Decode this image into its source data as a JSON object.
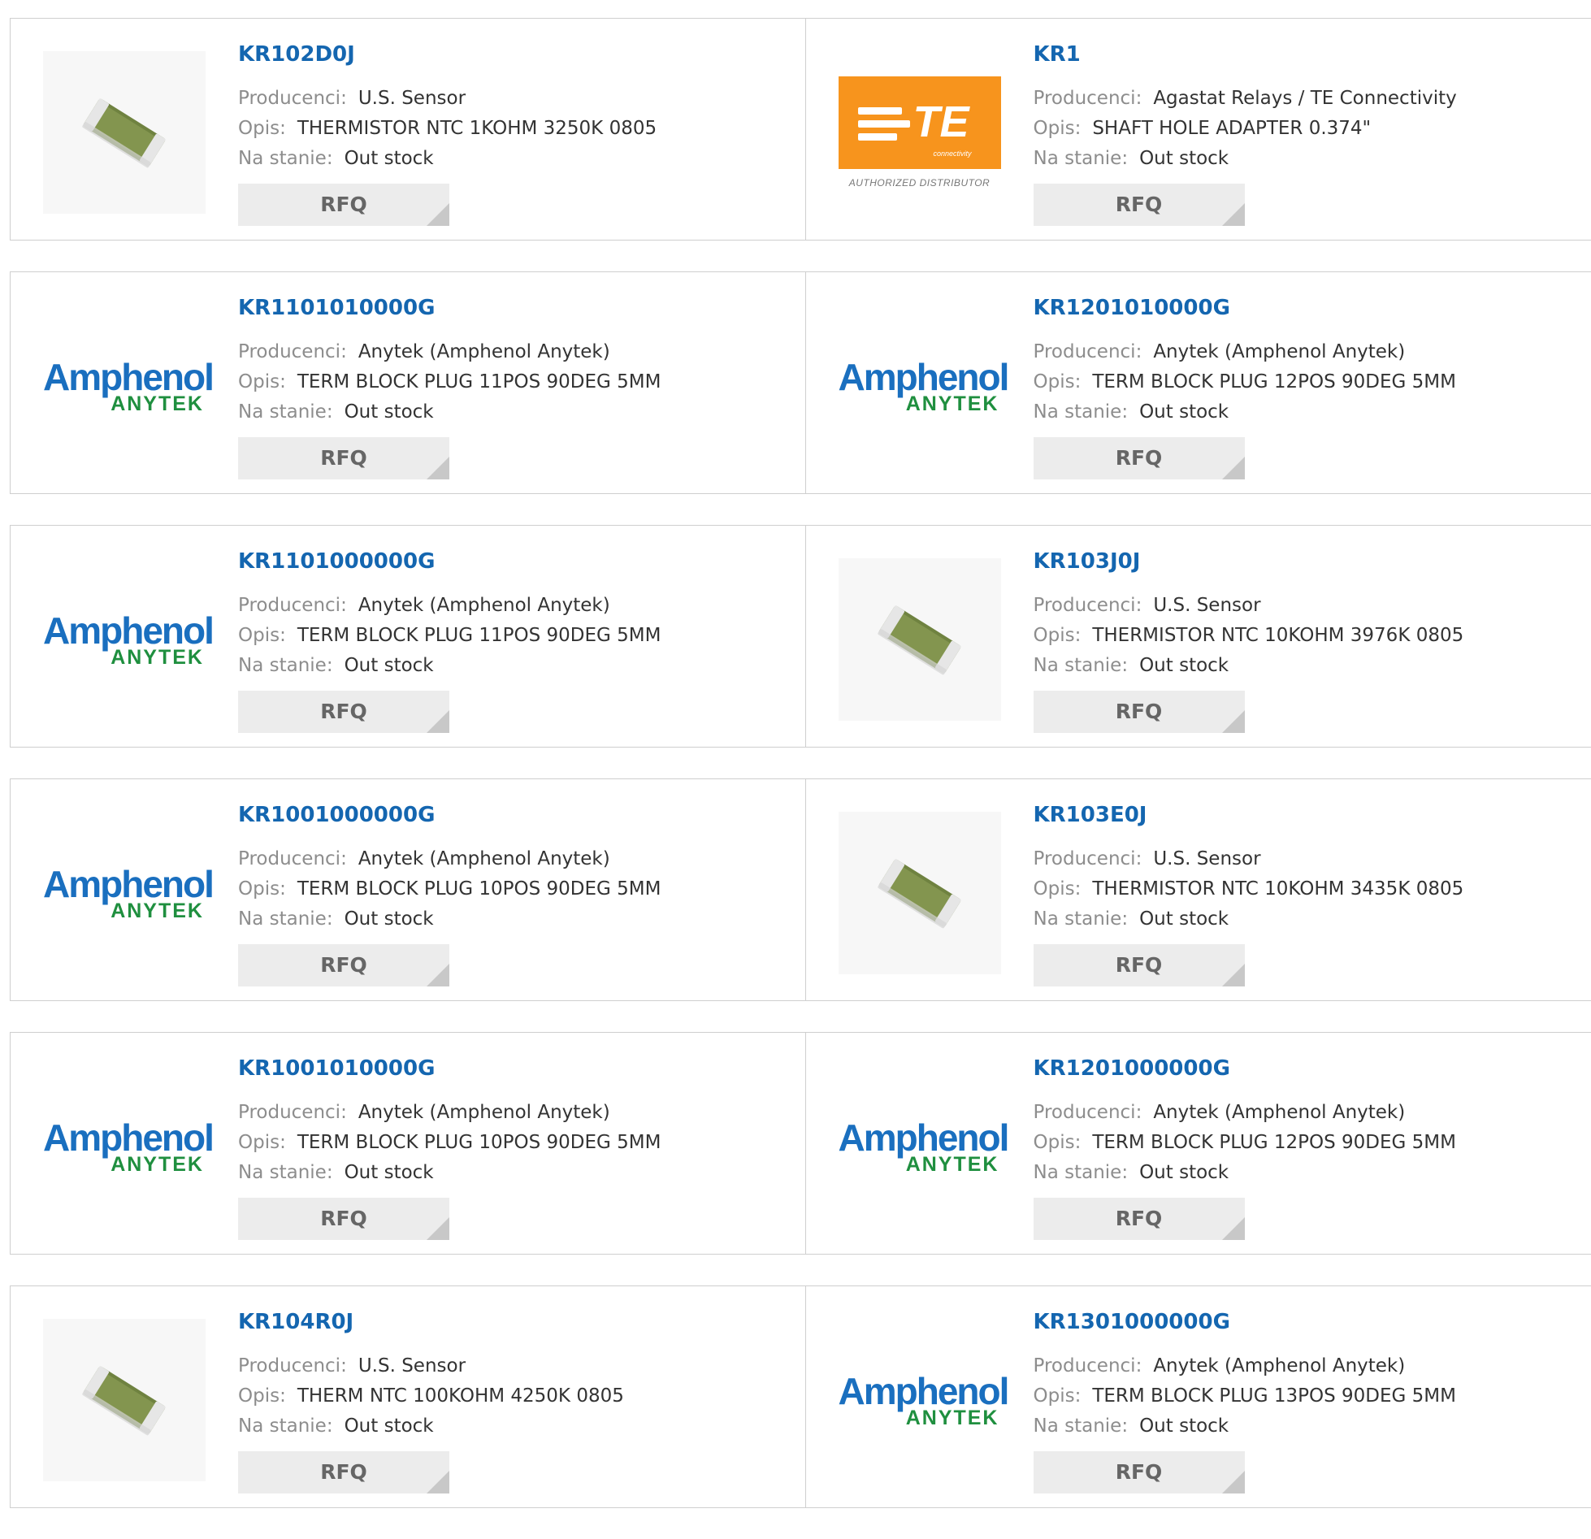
{
  "labels": {
    "manufacturer": "Producenci:",
    "description": "Opis:",
    "stock": "Na stanie:",
    "rfq": "RFQ"
  },
  "logos": {
    "amphenol_main": "Amphenol",
    "amphenol_sub": "ANYTEK",
    "te_main": "TE",
    "te_sub": "connectivity",
    "te_authorized": "AUTHORIZED DISTRIBUTOR"
  },
  "products": [
    {
      "part": "KR102D0J",
      "manufacturer": "U.S. Sensor",
      "description": "THERMISTOR NTC 1KOHM 3250K 0805",
      "stock": "Out stock",
      "image": "thermistor-chip"
    },
    {
      "part": "KR1",
      "manufacturer": "Agastat Relays / TE Connectivity",
      "description": "SHAFT HOLE ADAPTER 0.374\"",
      "stock": "Out stock",
      "image": "te-logo"
    },
    {
      "part": "KR1101010000G",
      "manufacturer": "Anytek (Amphenol Anytek)",
      "description": "TERM BLOCK PLUG 11POS 90DEG 5MM",
      "stock": "Out stock",
      "image": "amphenol-logo"
    },
    {
      "part": "KR1201010000G",
      "manufacturer": "Anytek (Amphenol Anytek)",
      "description": "TERM BLOCK PLUG 12POS 90DEG 5MM",
      "stock": "Out stock",
      "image": "amphenol-logo"
    },
    {
      "part": "KR1101000000G",
      "manufacturer": "Anytek (Amphenol Anytek)",
      "description": "TERM BLOCK PLUG 11POS 90DEG 5MM",
      "stock": "Out stock",
      "image": "amphenol-logo"
    },
    {
      "part": "KR103J0J",
      "manufacturer": "U.S. Sensor",
      "description": "THERMISTOR NTC 10KOHM 3976K 0805",
      "stock": "Out stock",
      "image": "thermistor-chip"
    },
    {
      "part": "KR1001000000G",
      "manufacturer": "Anytek (Amphenol Anytek)",
      "description": "TERM BLOCK PLUG 10POS 90DEG 5MM",
      "stock": "Out stock",
      "image": "amphenol-logo"
    },
    {
      "part": "KR103E0J",
      "manufacturer": "U.S. Sensor",
      "description": "THERMISTOR NTC 10KOHM 3435K 0805",
      "stock": "Out stock",
      "image": "thermistor-chip"
    },
    {
      "part": "KR1001010000G",
      "manufacturer": "Anytek (Amphenol Anytek)",
      "description": "TERM BLOCK PLUG 10POS 90DEG 5MM",
      "stock": "Out stock",
      "image": "amphenol-logo"
    },
    {
      "part": "KR1201000000G",
      "manufacturer": "Anytek (Amphenol Anytek)",
      "description": "TERM BLOCK PLUG 12POS 90DEG 5MM",
      "stock": "Out stock",
      "image": "amphenol-logo"
    },
    {
      "part": "KR104R0J",
      "manufacturer": "U.S. Sensor",
      "description": "THERM NTC 100KOHM 4250K 0805",
      "stock": "Out stock",
      "image": "thermistor-chip"
    },
    {
      "part": "KR1301000000G",
      "manufacturer": "Anytek (Amphenol Anytek)",
      "description": "TERM BLOCK PLUG 13POS 90DEG 5MM",
      "stock": "Out stock",
      "image": "amphenol-logo"
    }
  ],
  "colors": {
    "link": "#1466b0",
    "label": "#8d8d8d",
    "value": "#333333",
    "rfq_bg": "#ececec",
    "te_orange": "#f7941d",
    "amphenol_blue": "#1a6fbf",
    "anytek_green": "#1f8f3f"
  }
}
